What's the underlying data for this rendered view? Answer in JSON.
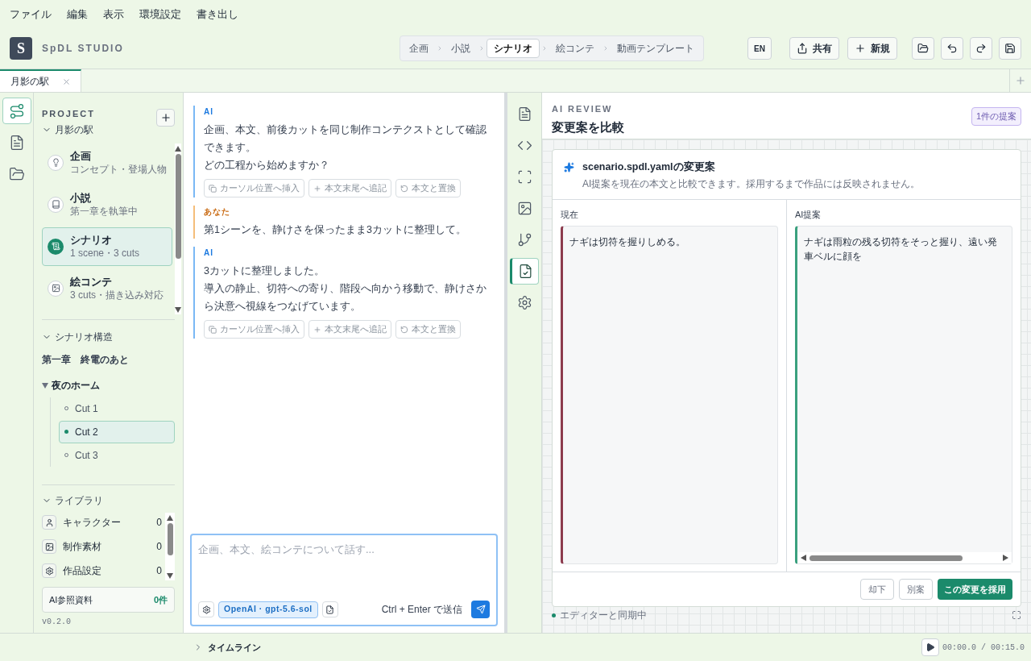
{
  "menu": [
    "ファイル",
    "編集",
    "表示",
    "環境設定",
    "書き出し"
  ],
  "app": {
    "logo": "S",
    "name": "SpDL STUDIO"
  },
  "stages": [
    {
      "label": "企画",
      "selected": false
    },
    {
      "label": "小説",
      "selected": false
    },
    {
      "label": "シナリオ",
      "selected": true
    },
    {
      "label": "絵コンテ",
      "selected": false
    },
    {
      "label": "動画テンプレート",
      "selected": false
    }
  ],
  "header": {
    "language": "EN",
    "share": "共有",
    "new": "新規"
  },
  "tabs": [
    {
      "label": "月影の駅",
      "selected": true
    }
  ],
  "rail": [
    {
      "kind": "flow",
      "selected": true
    },
    {
      "kind": "document",
      "selected": false
    },
    {
      "kind": "folder",
      "selected": false
    }
  ],
  "sidebar": {
    "heading": "PROJECT",
    "project": "月影の駅",
    "expanded": true,
    "documents": [
      {
        "kind": "idea",
        "title": "企画",
        "subtitle": "コンセプト・登場人物",
        "selected": false
      },
      {
        "kind": "book",
        "title": "小説",
        "subtitle": "第一章を執筆中",
        "selected": false
      },
      {
        "kind": "script",
        "title": "シナリオ",
        "subtitle": "1 scene・3 cuts",
        "selected": true
      },
      {
        "kind": "image",
        "title": "絵コンテ",
        "subtitle": "3 cuts・描き込み対応",
        "selected": false
      }
    ],
    "structure": {
      "heading": "シナリオ構造",
      "chapter": "第一章　終電のあと",
      "scene": "夜のホーム",
      "expanded": true,
      "cuts": [
        {
          "label": "Cut 1",
          "selected": false
        },
        {
          "label": "Cut 2",
          "selected": true
        },
        {
          "label": "Cut 3",
          "selected": false
        }
      ]
    },
    "library": {
      "heading": "ライブラリ",
      "items": [
        {
          "kind": "person",
          "label": "キャラクター",
          "count": "0"
        },
        {
          "kind": "image",
          "label": "制作素材",
          "count": "0"
        },
        {
          "kind": "settings",
          "label": "作品設定",
          "count": "0"
        }
      ]
    },
    "ai_refs": {
      "label": "AI参照資料",
      "count": "0件"
    },
    "version": "v0.2.0"
  },
  "chat": {
    "messages": [
      {
        "kind": "ai",
        "author": "AI",
        "lines": [
          "企画、本文、前後カットを同じ制作コンテクストとして確認できます。",
          "どの工程から始めますか？"
        ],
        "actions": [
          "カーソル位置へ挿入",
          "本文末尾へ追記",
          "本文と置換"
        ]
      },
      {
        "kind": "user",
        "author": "あなた",
        "lines": [
          "第1シーンを、静けさを保ったまま3カットに整理して。"
        ]
      },
      {
        "kind": "ai",
        "author": "AI",
        "lines": [
          "3カットに整理しました。",
          "導入の静止、切符への寄り、階段へ向かう移動で、静けさから決意へ視線をつなげています。"
        ],
        "actions": [
          "カーソル位置へ挿入",
          "本文末尾へ追記",
          "本文と置換"
        ]
      }
    ],
    "input": {
      "placeholder": "企画、本文、絵コンテについて話す...",
      "model": "OpenAI · gpt-5.6-sol",
      "hint": "Ctrl + Enter で送信"
    }
  },
  "tools": [
    {
      "kind": "document",
      "selected": false
    },
    {
      "kind": "code",
      "selected": false
    },
    {
      "kind": "frame",
      "selected": false
    },
    {
      "kind": "image",
      "selected": false
    },
    {
      "kind": "branch",
      "selected": false
    },
    {
      "kind": "review",
      "selected": true
    },
    {
      "kind": "settings",
      "selected": false
    }
  ],
  "review": {
    "eyebrow": "AI REVIEW",
    "title": "変更案を比較",
    "badge": "1件の提案",
    "card": {
      "title": "scenario.spdl.yamlの変更案",
      "subtitle": "AI提案を現在の本文と比較できます。採用するまで作品には反映されません。",
      "current_label": "現在",
      "current_text": "ナギは切符を握りしめる。",
      "proposal_label": "AI提案",
      "proposal_text": "ナギは雨粒の残る切符をそっと握り、遠い発車ベルに顔を",
      "buttons": [
        {
          "label": "却下",
          "kind": "secondary"
        },
        {
          "label": "別案",
          "kind": "secondary"
        },
        {
          "label": "この変更を採用",
          "kind": "primary"
        }
      ]
    },
    "status": "エディターと同期中"
  },
  "timeline": {
    "label": "タイムライン",
    "time": "00:00.0 / 00:15.0"
  }
}
